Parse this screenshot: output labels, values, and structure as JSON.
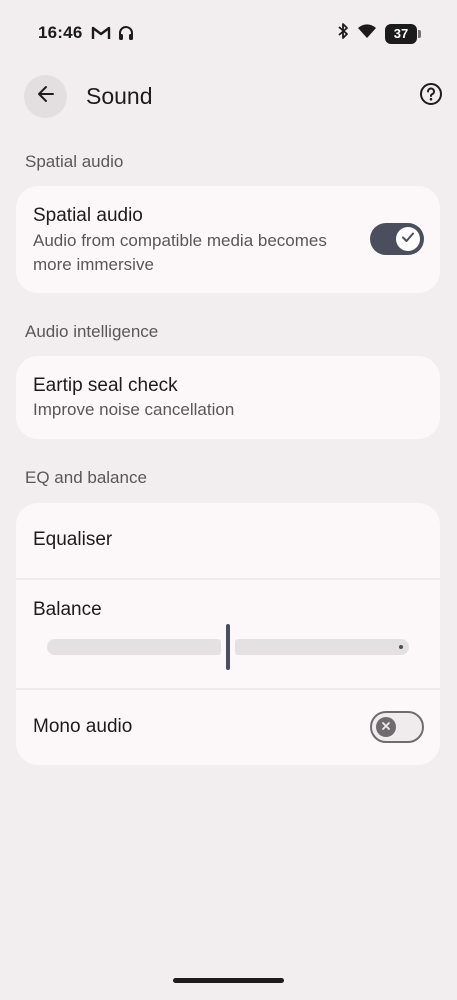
{
  "status_bar": {
    "time": "16:46",
    "battery_level": "37",
    "left_icons": [
      "gmail-icon",
      "headphones-icon"
    ],
    "right_icons": [
      "bluetooth-icon",
      "wifi-icon",
      "battery-icon"
    ]
  },
  "header": {
    "title": "Sound",
    "back_icon": "arrow-left-icon",
    "help_icon": "help-circle-icon"
  },
  "sections": {
    "spatial": {
      "header": "Spatial audio",
      "title": "Spatial audio",
      "subtitle": "Audio from compatible media becomes more immersive",
      "toggle_on": true
    },
    "audio_intelligence": {
      "header": "Audio intelligence",
      "title": "Eartip seal check",
      "subtitle": "Improve noise cancellation"
    },
    "eq_balance": {
      "header": "EQ and balance",
      "equaliser_label": "Equaliser",
      "balance_label": "Balance",
      "balance_value": 0.5,
      "mono_label": "Mono audio",
      "mono_on": false
    }
  },
  "colors": {
    "background": "#f2eeef",
    "card": "#fcf8f9",
    "accent": "#4b4e5c"
  }
}
